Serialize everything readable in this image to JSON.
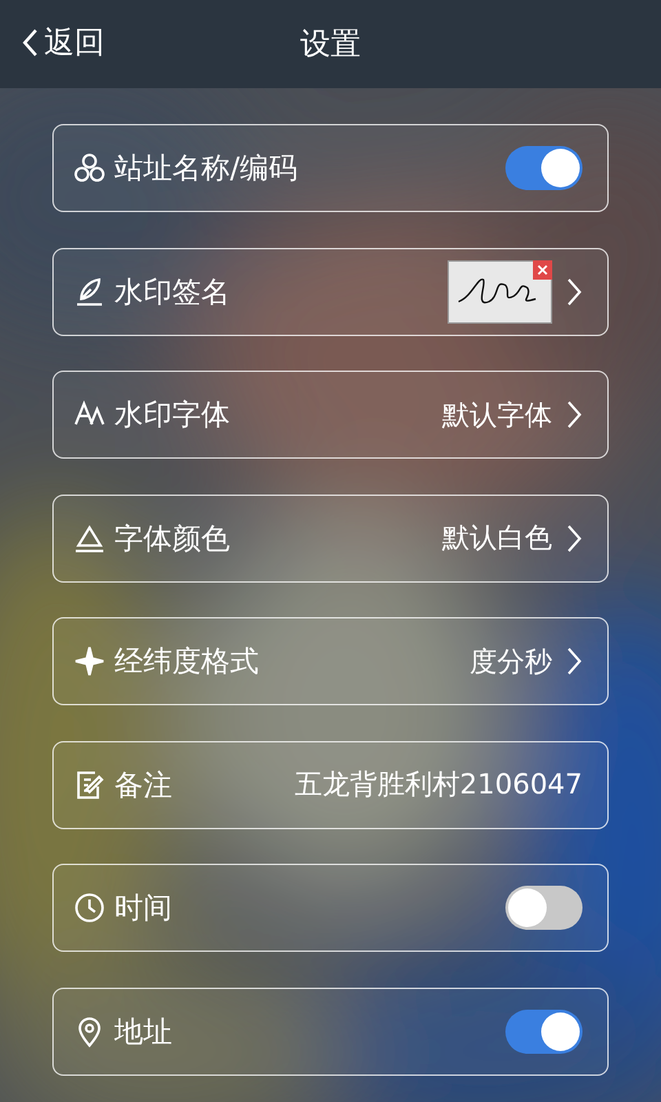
{
  "header": {
    "back": "返回",
    "title": "设置"
  },
  "rows": [
    {
      "kind": "toggle",
      "label": "站址名称/编码",
      "on": true
    },
    {
      "kind": "signature",
      "label": "水印签名"
    },
    {
      "kind": "value",
      "label": "水印字体",
      "value": "默认字体"
    },
    {
      "kind": "value",
      "label": "字体颜色",
      "value": "默认白色"
    },
    {
      "kind": "value",
      "label": "经纬度格式",
      "value": "度分秒"
    },
    {
      "kind": "note",
      "label": "备注",
      "value": "五龙背胜利村2106047"
    },
    {
      "kind": "toggle",
      "label": "时间",
      "on": false
    },
    {
      "kind": "toggle",
      "label": "地址",
      "on": true
    }
  ]
}
